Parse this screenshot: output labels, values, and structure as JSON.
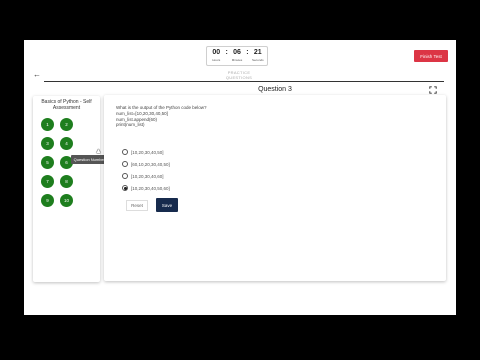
{
  "timer": {
    "hours": "00",
    "minutes": "06",
    "seconds": "21",
    "hours_label": "Hours",
    "minutes_label": "Minutes",
    "seconds_label": "Seconds",
    "separator": ":"
  },
  "header": {
    "finish_label": "Finish Test",
    "mode_label": "PRACTICE QUESTIONS",
    "back_icon": "arrow-left-icon"
  },
  "sidebar": {
    "title": "Basics of Python - Self Assessment",
    "questions": [
      "1",
      "2",
      "3",
      "4",
      "5",
      "6",
      "7",
      "8",
      "9",
      "10"
    ],
    "tooltip": "Question Number 5",
    "dot_color": "#1e7e1e"
  },
  "question": {
    "title": "Question 3",
    "lines": [
      "What is the output of the Python code below?",
      "num_list=[10,20,30,40,50]",
      "num_list.append(60)",
      "print(num_list)"
    ],
    "options": [
      "[10,20,30,40,50]",
      "[60,10,20,30,40,50]",
      "[10,20,30,40,60]",
      "[10,20,30,40,50,60]"
    ],
    "selected_index": 3,
    "reset_label": "Reset",
    "save_label": "Save",
    "expand_icon": "expand-icon"
  },
  "colors": {
    "finish": "#dc3545",
    "save": "#172b4d",
    "green": "#1e7e1e"
  }
}
